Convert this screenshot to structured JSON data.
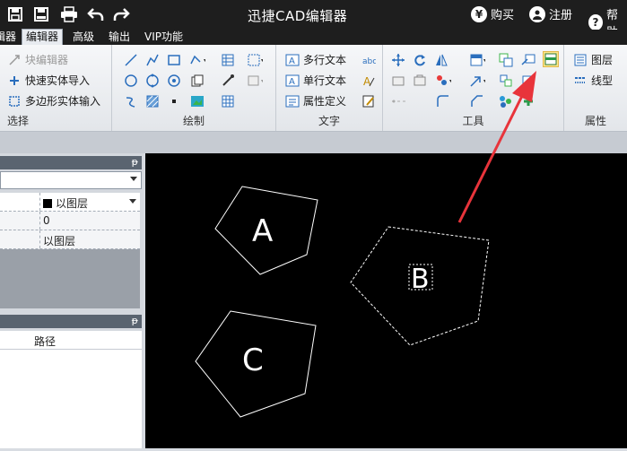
{
  "titlebar": {
    "title": "迅捷CAD编辑器",
    "buy": "购买",
    "register": "注册",
    "help_text": "帮助",
    "icons": [
      "save-icon",
      "save-as-icon",
      "print-icon",
      "undo-icon",
      "redo-icon"
    ]
  },
  "menu": {
    "tabs": [
      {
        "label": "编辑器",
        "active": false
      },
      {
        "label": "编辑器",
        "active": true
      },
      {
        "label": "高级",
        "active": false
      },
      {
        "label": "输出",
        "active": false
      },
      {
        "label": "VIP功能",
        "active": false
      }
    ]
  },
  "ribbon": {
    "select": {
      "label": "选择",
      "block_editor": "块编辑器",
      "quick_import": "快速实体导入",
      "polygon_input": "多边形实体输入"
    },
    "draw": {
      "label": "绘制"
    },
    "text": {
      "label": "文字",
      "mtext": "多行文本",
      "stext": "单行文本",
      "attdef": "属性定义"
    },
    "tools": {
      "label": "工具"
    },
    "props": {
      "label": "属性",
      "layer": "图层",
      "linetype": "线型"
    }
  },
  "panel": {
    "layer_value": "以图层",
    "row2_value": "0",
    "row3_value": "以图层",
    "path_header": "路径"
  },
  "canvas": {
    "shapes": [
      {
        "label": "A",
        "selected": false
      },
      {
        "label": "B",
        "selected": true
      },
      {
        "label": "C",
        "selected": false
      }
    ],
    "arrow_color": "#e8343b"
  },
  "colors": {
    "titlebar": "#1e1e1e",
    "highlight": "#fde78a",
    "canvas": "#000000"
  }
}
